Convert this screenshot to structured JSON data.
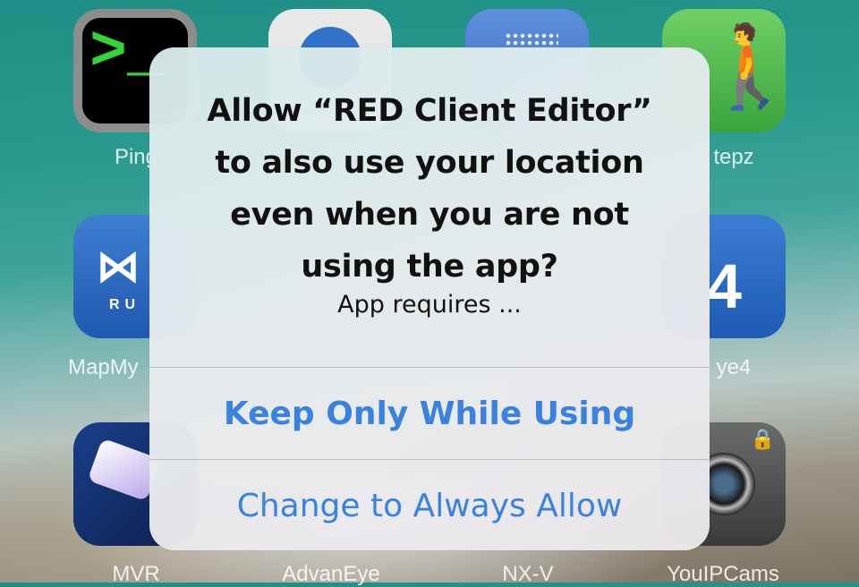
{
  "home_screen": {
    "icons": [
      {
        "label": "Ping",
        "icon": "terminal-icon",
        "prompt": ">_"
      },
      {
        "label": "",
        "icon": "app-icon"
      },
      {
        "label": "",
        "icon": "app-icon"
      },
      {
        "label": "tepz",
        "icon": "walking-person-icon"
      },
      {
        "label": "MapMy",
        "icon": "under-armour-icon",
        "badge_text": "RU"
      },
      {
        "label": "ye4",
        "icon": "eye4-icon"
      },
      {
        "label": "MVR",
        "icon": "card-icon"
      },
      {
        "label": "AdvanEye",
        "icon": "app-icon"
      },
      {
        "label": "NX-V",
        "icon": "app-icon"
      },
      {
        "label": "YouIPCams",
        "icon": "camera-icon"
      }
    ]
  },
  "alert": {
    "title": "Allow “RED Client Editor” to also use your location even when you are not using the app?",
    "message": "App requires ...",
    "buttons": [
      {
        "label": "Keep Only While Using",
        "style": "bold"
      },
      {
        "label": "Change to Always Allow",
        "style": "regular"
      }
    ],
    "button_color": "#3a82e0"
  }
}
